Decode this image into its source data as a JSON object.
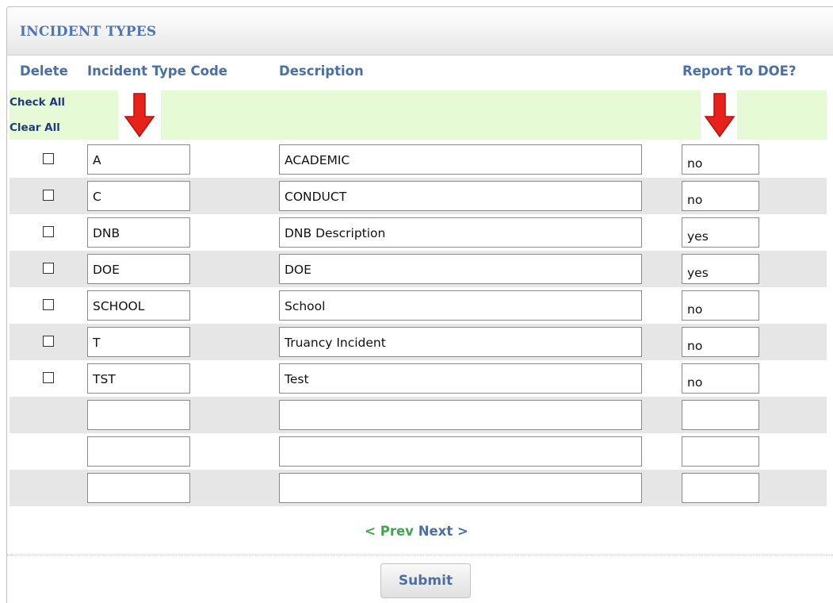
{
  "panel": {
    "title": "INCIDENT TYPES"
  },
  "headers": {
    "delete": "Delete",
    "code": "Incident Type Code",
    "description": "Description",
    "report": "Report To DOE?"
  },
  "links": {
    "check_all": "Check All",
    "clear_all": "Clear All"
  },
  "rows": [
    {
      "code": "A",
      "description": "ACADEMIC",
      "report": "no"
    },
    {
      "code": "C",
      "description": "CONDUCT",
      "report": "no"
    },
    {
      "code": "DNB",
      "description": "DNB Description",
      "report": "yes"
    },
    {
      "code": "DOE",
      "description": "DOE",
      "report": "yes"
    },
    {
      "code": "SCHOOL",
      "description": "School",
      "report": "no"
    },
    {
      "code": "T",
      "description": "Truancy Incident",
      "report": "no"
    },
    {
      "code": "TST",
      "description": "Test",
      "report": "no"
    },
    {
      "code": "",
      "description": "",
      "report": ""
    },
    {
      "code": "",
      "description": "",
      "report": ""
    },
    {
      "code": "",
      "description": "",
      "report": ""
    }
  ],
  "pager": {
    "prev": "< Prev",
    "next": "Next >"
  },
  "submit_label": "Submit",
  "colors": {
    "title": "#4f76b3",
    "header": "#4a6fa5",
    "link": "#1f3b80",
    "prev": "#3fa64f",
    "highlight_band": "#e6fad6",
    "alt_row": "#e6e6e6",
    "arrow": "#e8211a"
  },
  "icons": {
    "annotation": "red-down-arrow-icon"
  }
}
